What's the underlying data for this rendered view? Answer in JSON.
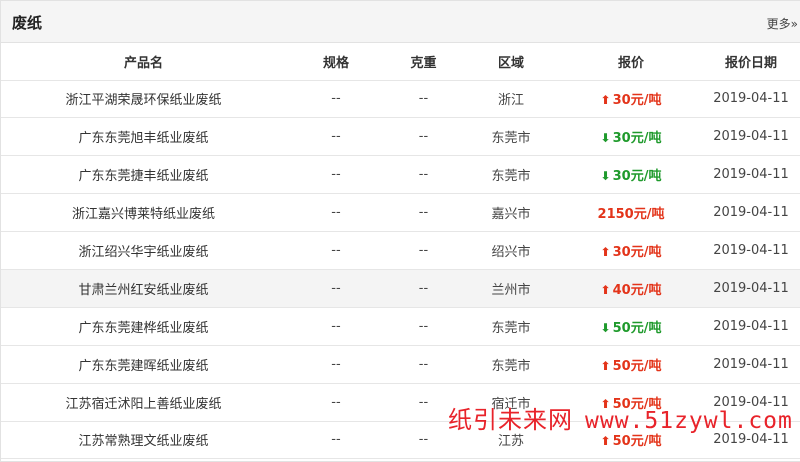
{
  "header": {
    "title": "废纸",
    "more_label": "更多»"
  },
  "columns": [
    "产品名",
    "规格",
    "克重",
    "区域",
    "报价",
    "报价日期"
  ],
  "rows": [
    {
      "name": "浙江平湖荣晟环保纸业废纸",
      "spec": "--",
      "weight": "--",
      "region": "浙江",
      "trend": "up",
      "price": "30元/吨",
      "date": "2019-04-11"
    },
    {
      "name": "广东东莞旭丰纸业废纸",
      "spec": "--",
      "weight": "--",
      "region": "东莞市",
      "trend": "down",
      "price": "30元/吨",
      "date": "2019-04-11"
    },
    {
      "name": "广东东莞捷丰纸业废纸",
      "spec": "--",
      "weight": "--",
      "region": "东莞市",
      "trend": "down",
      "price": "30元/吨",
      "date": "2019-04-11"
    },
    {
      "name": "浙江嘉兴博莱特纸业废纸",
      "spec": "--",
      "weight": "--",
      "region": "嘉兴市",
      "trend": "flat",
      "price": "2150元/吨",
      "date": "2019-04-11"
    },
    {
      "name": "浙江绍兴华宇纸业废纸",
      "spec": "--",
      "weight": "--",
      "region": "绍兴市",
      "trend": "up",
      "price": "30元/吨",
      "date": "2019-04-11"
    },
    {
      "name": "甘肃兰州红安纸业废纸",
      "spec": "--",
      "weight": "--",
      "region": "兰州市",
      "trend": "up",
      "price": "40元/吨",
      "date": "2019-04-11"
    },
    {
      "name": "广东东莞建桦纸业废纸",
      "spec": "--",
      "weight": "--",
      "region": "东莞市",
      "trend": "down",
      "price": "50元/吨",
      "date": "2019-04-11"
    },
    {
      "name": "广东东莞建晖纸业废纸",
      "spec": "--",
      "weight": "--",
      "region": "东莞市",
      "trend": "up",
      "price": "50元/吨",
      "date": "2019-04-11"
    },
    {
      "name": "江苏宿迁沭阳上善纸业废纸",
      "spec": "--",
      "weight": "--",
      "region": "宿迁市",
      "trend": "up",
      "price": "50元/吨",
      "date": "2019-04-11"
    },
    {
      "name": "江苏常熟理文纸业废纸",
      "spec": "--",
      "weight": "--",
      "region": "江苏",
      "trend": "up",
      "price": "50元/吨",
      "date": "2019-04-11"
    }
  ],
  "highlighted_row": 5,
  "colors": {
    "up": "#e3341a",
    "down": "#1f9a2c",
    "watermark": "#e8232a"
  },
  "watermark": {
    "cn": "纸引未来网",
    "url": "www.51zywl.com"
  }
}
